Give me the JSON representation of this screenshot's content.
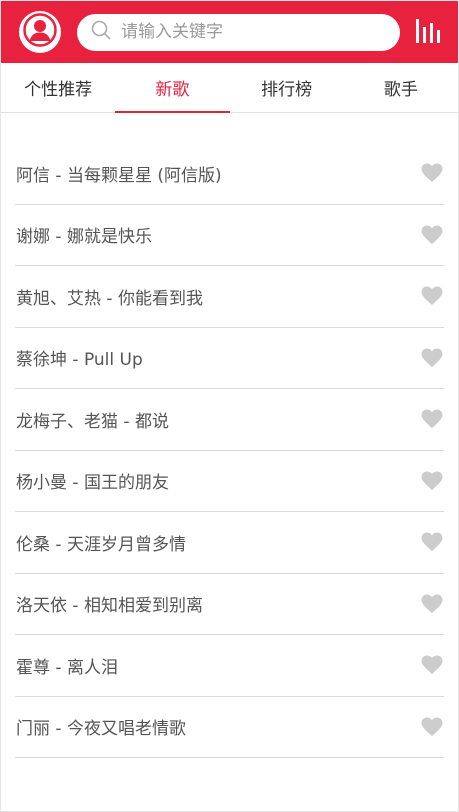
{
  "header": {
    "search_placeholder": "请输入关键字",
    "icons": {
      "avatar": "user-avatar-icon",
      "search": "search-icon",
      "ranking": "bar-chart-icon"
    }
  },
  "tabs": [
    {
      "label": "个性推荐",
      "active": false
    },
    {
      "label": "新歌",
      "active": true
    },
    {
      "label": "排行榜",
      "active": false
    },
    {
      "label": "歌手",
      "active": false
    }
  ],
  "songs": [
    {
      "title": "阿信 - 当每颗星星 (阿信版)"
    },
    {
      "title": "谢娜 - 娜就是快乐"
    },
    {
      "title": "黄旭、艾热 - 你能看到我"
    },
    {
      "title": "蔡徐坤 - Pull Up"
    },
    {
      "title": "龙梅子、老猫 - 都说"
    },
    {
      "title": "杨小曼 - 国王的朋友"
    },
    {
      "title": "伦桑 - 天涯岁月曾多情"
    },
    {
      "title": "洛天依 - 相知相爱到别离"
    },
    {
      "title": "霍尊 - 离人泪"
    },
    {
      "title": "门丽 - 今夜又唱老情歌"
    }
  ],
  "colors": {
    "brand": "#e8213e",
    "heart": "#cccccc",
    "divider": "#d9d9d9"
  }
}
